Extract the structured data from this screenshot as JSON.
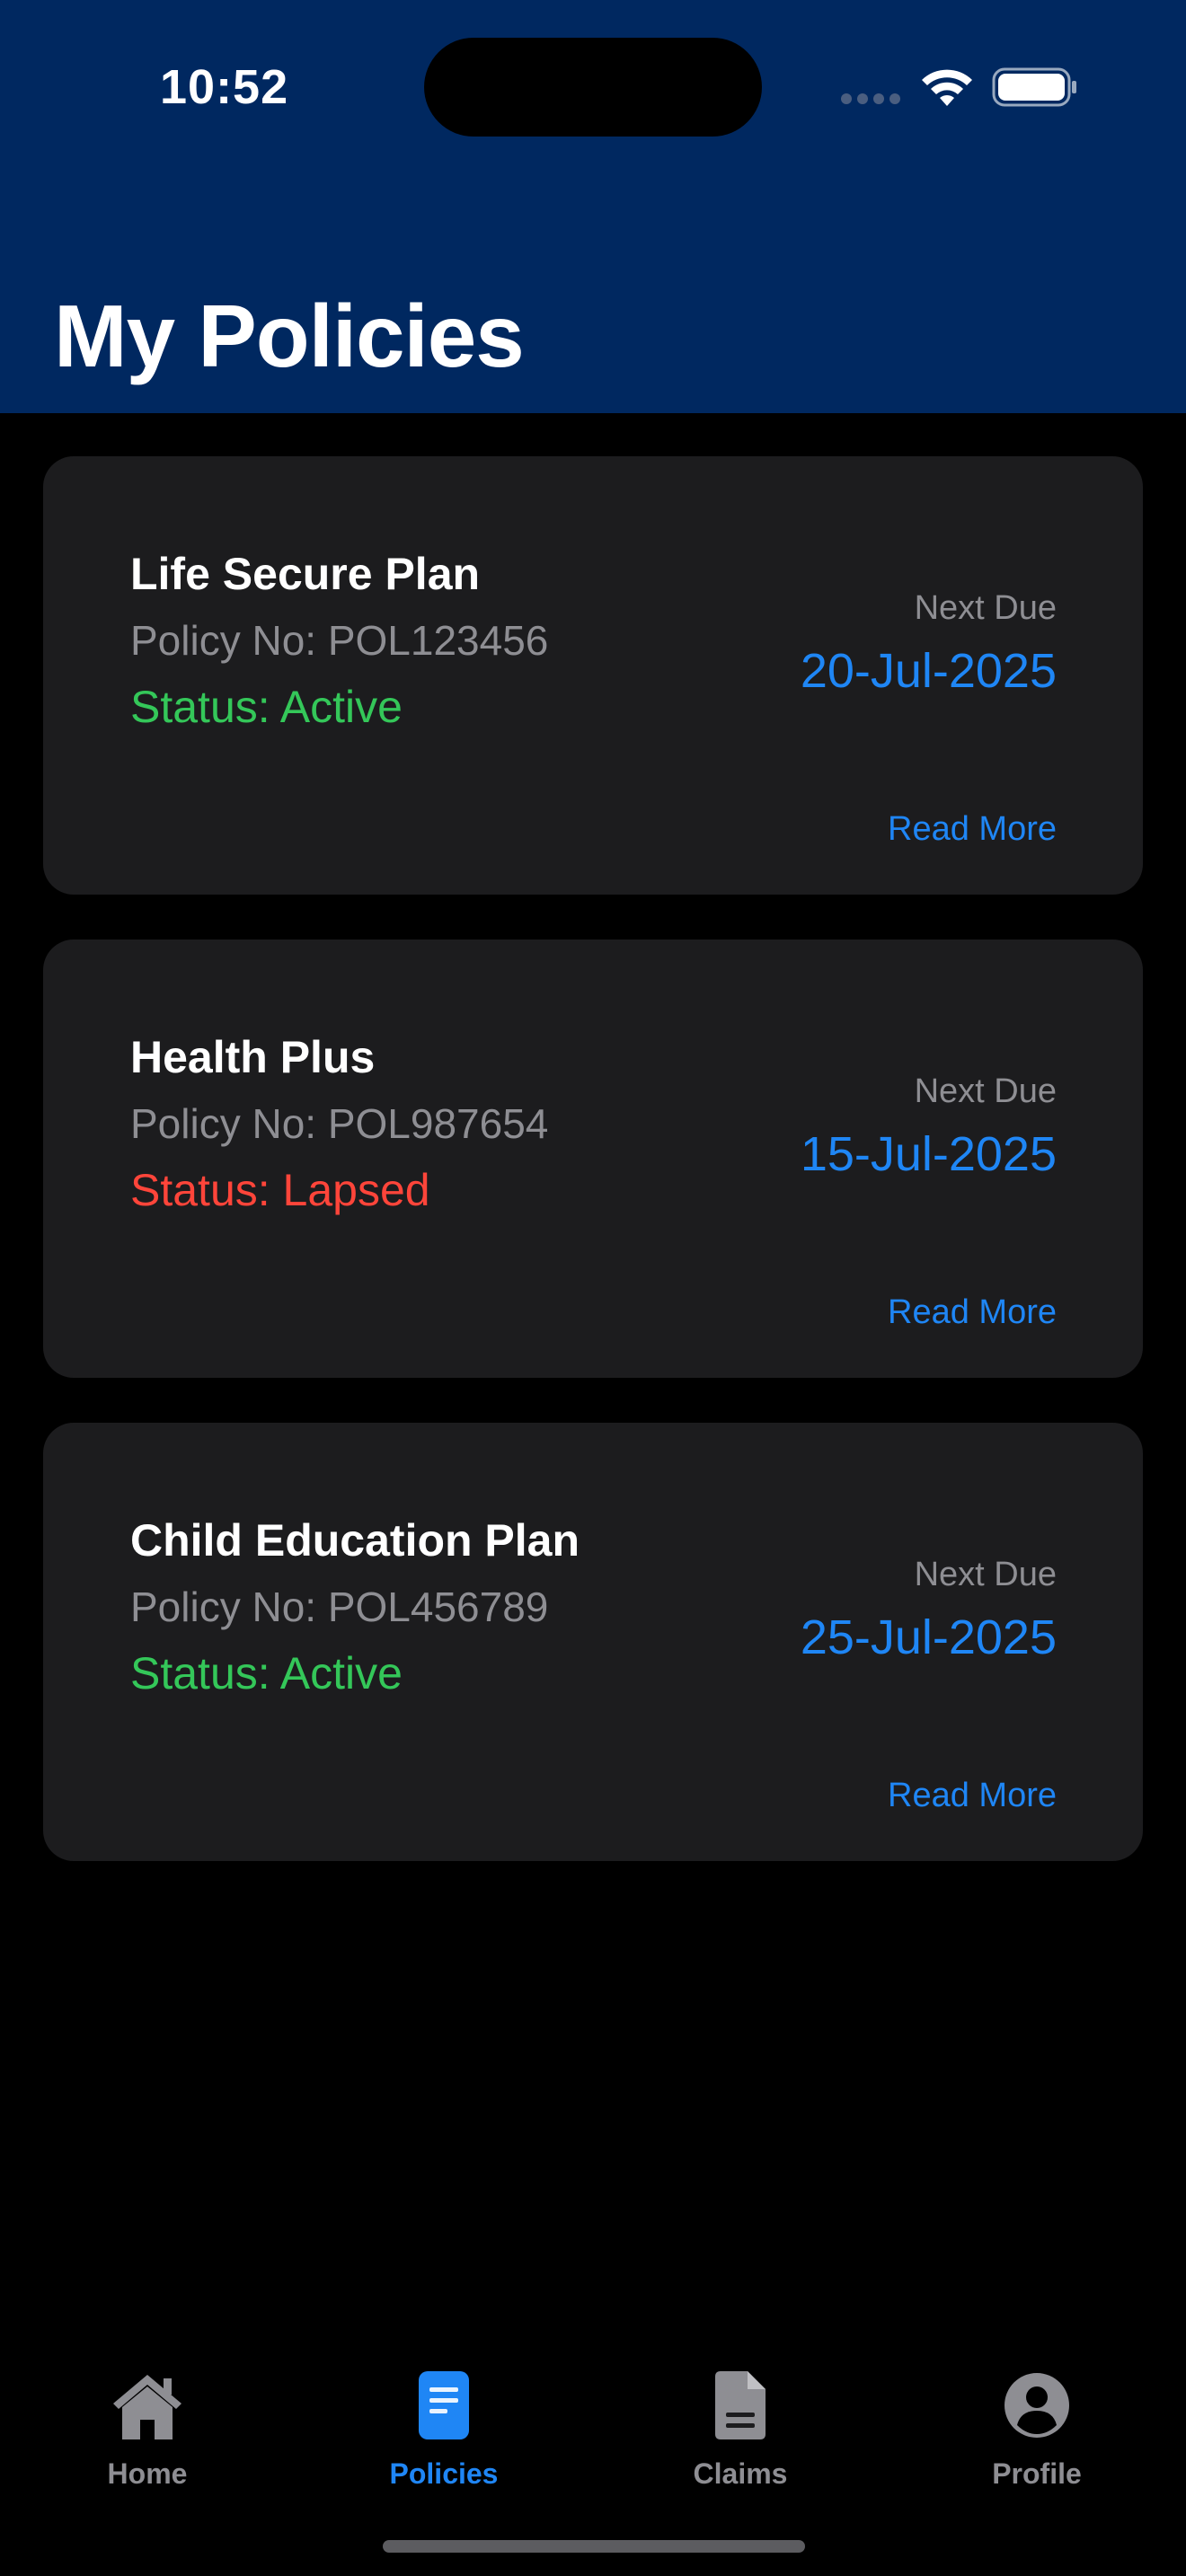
{
  "status_bar": {
    "time": "10:52"
  },
  "header": {
    "title": "My Policies",
    "background": "#002860"
  },
  "policies": [
    {
      "name": "Life Secure Plan",
      "policy_no": "Policy No: POL123456",
      "status": "Status: Active",
      "status_color": "#34c759",
      "next_due_label": "Next Due",
      "next_due_date": "20-Jul-2025",
      "read_more": "Read More"
    },
    {
      "name": "Health Plus",
      "policy_no": "Policy No: POL987654",
      "status": "Status: Lapsed",
      "status_color": "#ff453a",
      "next_due_label": "Next Due",
      "next_due_date": "15-Jul-2025",
      "read_more": "Read More"
    },
    {
      "name": "Child Education Plan",
      "policy_no": "Policy No: POL456789",
      "status": "Status: Active",
      "status_color": "#34c759",
      "next_due_label": "Next Due",
      "next_due_date": "25-Jul-2025",
      "read_more": "Read More"
    }
  ],
  "tabbar": {
    "tabs": [
      {
        "label": "Home",
        "icon": "house-icon",
        "active": false
      },
      {
        "label": "Policies",
        "icon": "document-icon",
        "active": true
      },
      {
        "label": "Claims",
        "icon": "file-icon",
        "active": false
      },
      {
        "label": "Profile",
        "icon": "person-circle-icon",
        "active": false
      }
    ]
  },
  "colors": {
    "accent": "#1f86f5",
    "card_background": "#1c1c1e",
    "secondary_text": "#8e8e93"
  }
}
